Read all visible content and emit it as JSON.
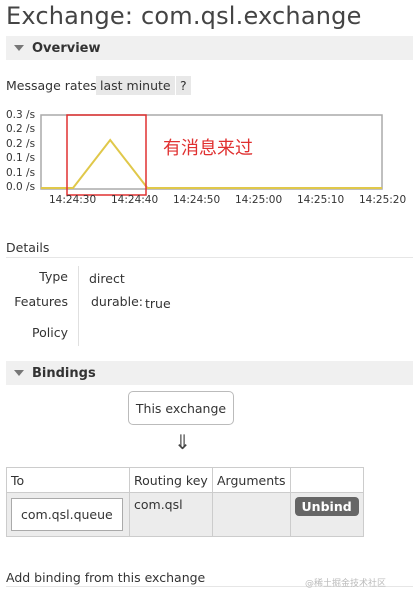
{
  "page": {
    "title": "Exchange: com.qsl.exchange"
  },
  "overview": {
    "header": "Overview",
    "message_rates_label": "Message rates",
    "period_chip": "last minute",
    "help_chip": "?",
    "annotation": "有消息来过",
    "colors": {
      "series": "#e0c84a",
      "annotation": "#e03030",
      "plot_border": "#aaa"
    }
  },
  "chart_data": {
    "type": "line",
    "y_ticks": [
      "0.3 /s",
      "0.2 /s",
      "0.2 /s",
      "0.1 /s",
      "0.1 /s",
      "0.0 /s"
    ],
    "x_ticks": [
      "14:24:30",
      "14:24:40",
      "14:24:50",
      "14:25:00",
      "14:25:10",
      "14:25:20"
    ],
    "ylim": [
      0,
      0.3
    ],
    "grid": false,
    "series": [
      {
        "x": [
          "14:24:24",
          "14:24:30",
          "14:24:36",
          "14:24:42",
          "14:25:24"
        ],
        "values": [
          0,
          0,
          0.2,
          0,
          0
        ]
      }
    ]
  },
  "details": {
    "label": "Details",
    "type_key": "Type",
    "type_value": "direct",
    "features_key": "Features",
    "durable_key": "durable:",
    "durable_value": "true",
    "policy_key": "Policy",
    "policy_value": ""
  },
  "bindings": {
    "header": "Bindings",
    "this_exchange": "This exchange",
    "arrow": "⇓",
    "columns": [
      "To",
      "Routing key",
      "Arguments",
      ""
    ],
    "rows": [
      {
        "to": "com.qsl.queue",
        "routing_key": "com.qsl",
        "arguments": "",
        "action": "Unbind"
      }
    ]
  },
  "add_binding": {
    "label": "Add binding from this exchange"
  },
  "watermark": "@稀土掘金技术社区"
}
